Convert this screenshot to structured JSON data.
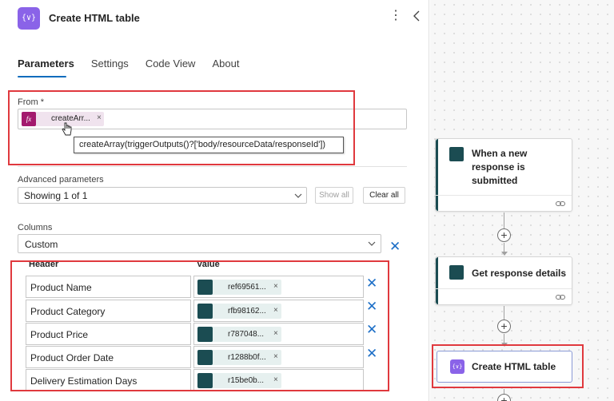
{
  "header": {
    "icon_glyph": "{∨}",
    "title": "Create HTML table",
    "more_glyph": "⋮"
  },
  "tabs": [
    {
      "label": "Parameters",
      "active": true
    },
    {
      "label": "Settings",
      "active": false
    },
    {
      "label": "Code View",
      "active": false
    },
    {
      "label": "About",
      "active": false
    }
  ],
  "from": {
    "label": "From *",
    "token_text": "createArr...",
    "token_icon": "fx",
    "remove_glyph": "×",
    "tooltip": "createArray(triggerOutputs()?['body/resourceData/responseId'])"
  },
  "advanced": {
    "label": "Advanced parameters",
    "selected": "Showing 1 of 1",
    "show_all": "Show all",
    "clear_all": "Clear all"
  },
  "columns": {
    "label": "Columns",
    "selected": "Custom",
    "clear_glyph": "✕",
    "header_label": "Header",
    "value_label": "Value",
    "rows": [
      {
        "header": "Product Name",
        "value": "ref69561...",
        "remove": "×",
        "delete": "✕"
      },
      {
        "header": "Product Category",
        "value": "rfb98162...",
        "remove": "×",
        "delete": "✕"
      },
      {
        "header": "Product Price",
        "value": "r787048...",
        "remove": "×",
        "delete": "✕"
      },
      {
        "header": "Product Order Date",
        "value": "r1288b0f...",
        "remove": "×",
        "delete": "✕"
      },
      {
        "header": "Delivery Estimation Days",
        "value": "r15be0b...",
        "remove": "×",
        "delete": ""
      }
    ]
  },
  "flow": {
    "cards": [
      {
        "title_lines": [
          "When a new",
          "response is",
          "submitted"
        ],
        "icon": "forms-icon"
      },
      {
        "title_lines": [
          "Get response details"
        ],
        "icon": "forms-icon"
      }
    ],
    "plus_glyph": "+",
    "selected_card": {
      "title": "Create HTML table",
      "icon_glyph": "{∨}"
    }
  },
  "colors": {
    "accent": "#0f6cbd",
    "highlight": "#e0393e",
    "forms": "#1b4c52",
    "data_op": "#8a63e8",
    "expression": "#a31a6e"
  }
}
